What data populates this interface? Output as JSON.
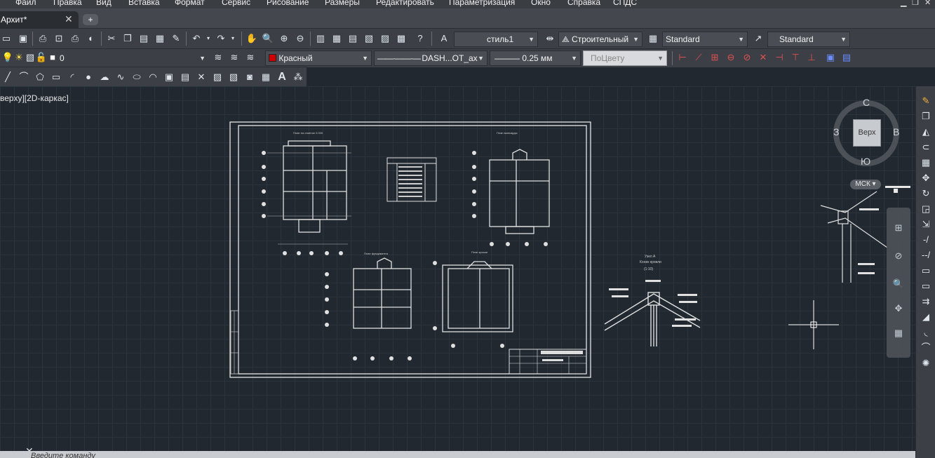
{
  "menu": {
    "items": [
      "Файл",
      "Правка",
      "Вид",
      "Вставка",
      "Формат",
      "Сервис",
      "Рисование",
      "Размеры",
      "Редактировать",
      "Параметризация",
      "Окно",
      "Справка",
      "СПДС"
    ]
  },
  "tabs": {
    "active": "Архит*",
    "new_tab": "+"
  },
  "toolbar": {
    "text_style": "стиль1",
    "dim_style": "Строительный",
    "table_style": "Standard",
    "multileader_style": "Standard"
  },
  "layers": {
    "current": "0",
    "color": "Красный",
    "color_hex": "#cc0000",
    "linetype": "DASH...OT_ax",
    "lineweight": "0.25 мм",
    "plotstyle": "ПоЦвету"
  },
  "viewport": {
    "label": "верху][2D-каркас]"
  },
  "viewcube": {
    "north": "С",
    "south": "Ю",
    "west": "З",
    "east": "В",
    "face": "Верх",
    "ucs": "МСК"
  },
  "drawing": {
    "plan1_title": "План на отметке 0.000",
    "plan2_title": "План мансарды",
    "plan3_title": "План фундамента",
    "plan4_title": "План крыши",
    "node_title": "Узел А",
    "node_subtitle": "Конек кровли",
    "node_scale": "(1:10)"
  },
  "command": {
    "placeholder": "Введите команду"
  }
}
